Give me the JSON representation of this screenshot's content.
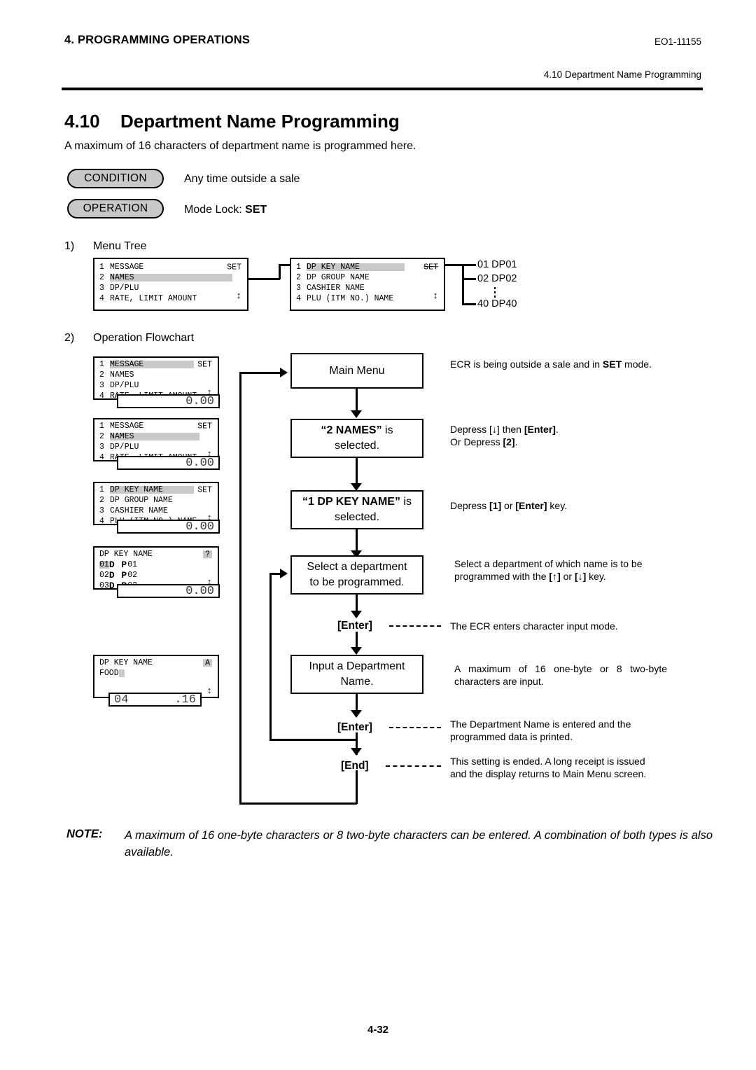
{
  "header": {
    "left": "4. PROGRAMMING OPERATIONS",
    "doc_code": "EO1-11155",
    "running_head": "4.10 Department Name Programming"
  },
  "title": {
    "number": "4.10",
    "text": "Department Name Programming",
    "intro": "A maximum of 16 characters of department name is programmed here."
  },
  "badges": {
    "condition_label": "CONDITION",
    "condition_text": "Any time outside a sale",
    "operation_label": "OPERATION",
    "operation_prefix": "Mode Lock: ",
    "operation_mode": "SET"
  },
  "sections": {
    "one_no": "1)",
    "one_label": "Menu Tree",
    "two_no": "2)",
    "two_label": "Operation Flowchart"
  },
  "menu_tree": {
    "box1": {
      "rows": [
        {
          "idx": "1",
          "text": "MESSAGE",
          "highlight": false
        },
        {
          "idx": "2",
          "text": "NAMES",
          "highlight": true
        },
        {
          "idx": "3",
          "text": "DP/PLU",
          "highlight": false
        },
        {
          "idx": "4",
          "text": "RATE, LIMIT AMOUNT",
          "highlight": false
        }
      ],
      "mode": "SET",
      "scroll": "↕"
    },
    "box2": {
      "rows": [
        {
          "idx": "1",
          "text": "DP KEY NAME",
          "highlight": true
        },
        {
          "idx": "2",
          "text": "DP GROUP NAME",
          "highlight": false
        },
        {
          "idx": "3",
          "text": "CASHIER NAME",
          "highlight": false
        },
        {
          "idx": "4",
          "text": "PLU (ITM NO.) NAME",
          "highlight": false
        }
      ],
      "mode": "SET",
      "scroll": "↕"
    },
    "departments": [
      {
        "no": "01",
        "name": "DP01"
      },
      {
        "no": "02",
        "name": "DP02"
      },
      {
        "no": "40",
        "name": "DP40"
      }
    ]
  },
  "lcd_panels": [
    {
      "name": "main-menu-message-selected",
      "rows": [
        {
          "idx": "1",
          "text": "MESSAGE",
          "highlight": true
        },
        {
          "idx": "2",
          "text": "NAMES",
          "highlight": false
        },
        {
          "idx": "3",
          "text": "DP/PLU",
          "highlight": false
        },
        {
          "idx": "4",
          "text": "RATE, LIMIT AMOUNT",
          "highlight": false
        }
      ],
      "mode": "SET",
      "scroll": "↕",
      "value_left": "",
      "value_right": "0.00"
    },
    {
      "name": "main-menu-names-selected",
      "rows": [
        {
          "idx": "1",
          "text": "MESSAGE",
          "highlight": false
        },
        {
          "idx": "2",
          "text": "NAMES",
          "highlight": true
        },
        {
          "idx": "3",
          "text": "DP/PLU",
          "highlight": false
        },
        {
          "idx": "4",
          "text": "RATE, LIMIT AMOUNT",
          "highlight": false
        }
      ],
      "mode": "SET",
      "scroll": "↕",
      "value_left": "",
      "value_right": "0.00"
    },
    {
      "name": "names-menu-dp-key-name-selected",
      "rows": [
        {
          "idx": "1",
          "text": "DP KEY NAME",
          "highlight": true
        },
        {
          "idx": "2",
          "text": "DP GROUP NAME",
          "highlight": false
        },
        {
          "idx": "3",
          "text": "CASHIER NAME",
          "highlight": false
        },
        {
          "idx": "4",
          "text": "PLU (ITM NO.) NAME",
          "highlight": false
        }
      ],
      "mode": "SET",
      "scroll": "↕",
      "value_left": "",
      "value_right": "0.00"
    }
  ],
  "lcd_dept_list": {
    "title": "DP KEY NAME",
    "indicator": "?",
    "rows": [
      {
        "no": "01",
        "dp": "D P",
        "num": "01",
        "highlight": true
      },
      {
        "no": "02",
        "dp": "D P",
        "num": "02",
        "highlight": false
      },
      {
        "no": "03",
        "dp": "D P",
        "num": "03",
        "highlight": false
      }
    ],
    "scroll": "↕",
    "value_left": "",
    "value_right": "0.00"
  },
  "lcd_input": {
    "title": "DP KEY NAME",
    "indicator": "A",
    "entry": "FOOD",
    "scroll": "↕",
    "value_left": "04",
    "value_right": ".16"
  },
  "flowchart": {
    "boxes": [
      {
        "name": "main-menu",
        "line1": "Main Menu",
        "line2": ""
      },
      {
        "name": "names-selected",
        "line1_bold": "“2 NAMES”",
        "line1_rest": " is",
        "line2": "selected."
      },
      {
        "name": "dp-key-name-selected",
        "line1_bold": "“1 DP KEY NAME”",
        "line1_rest": " is",
        "line2": "selected."
      },
      {
        "name": "select-department",
        "line1": "Select a department",
        "line2": "to be programmed."
      },
      {
        "name": "input-department-name",
        "line1": "Input a Department",
        "line2": "Name."
      }
    ],
    "keys": [
      {
        "name": "enter-key-1",
        "label": "[Enter]"
      },
      {
        "name": "enter-key-2",
        "label": "[Enter]"
      },
      {
        "name": "end-key",
        "label": "[End]"
      }
    ]
  },
  "annotations": [
    {
      "name": "annotation-main-menu",
      "pre": "ECR is being outside a sale and in ",
      "bold": "SET",
      "post": " mode."
    },
    {
      "name": "annotation-names",
      "l1_pre": "Depress [",
      "l1_arrow": "↓",
      "l1_mid": "] then ",
      "l1_bold": "[Enter]",
      "l1_post": ".",
      "l2_pre": "Or Depress ",
      "l2_bold": "[2]",
      "l2_post": "."
    },
    {
      "name": "annotation-dp-key-name",
      "pre": "Depress ",
      "b1": "[1]",
      "mid": " or ",
      "b2": "[Enter]",
      "post": " key."
    },
    {
      "name": "annotation-select-department",
      "l1": "Select a department of which name is to be",
      "l2_pre": "programmed with the ",
      "l2_b1": "[↑]",
      "l2_mid": " or ",
      "l2_b2": "[↓]",
      "l2_post": " key."
    },
    {
      "name": "annotation-enter-char-mode",
      "text": "The ECR enters character input mode."
    },
    {
      "name": "annotation-max-chars",
      "l1": "A maximum of 16 one-byte or 8 two-byte",
      "l2": "characters are input."
    },
    {
      "name": "annotation-name-entered",
      "l1": "The Department Name is entered and the",
      "l2": "programmed data is printed."
    },
    {
      "name": "annotation-setting-ended",
      "l1": "This setting is ended.  A long receipt is issued",
      "l2": "and the display returns to Main Menu screen."
    }
  ],
  "note": {
    "label": "NOTE:",
    "text": "A maximum of 16 one-byte characters or 8 two-byte characters can be entered.  A combination of both types is also available."
  },
  "footer": {
    "page": "4-32"
  }
}
